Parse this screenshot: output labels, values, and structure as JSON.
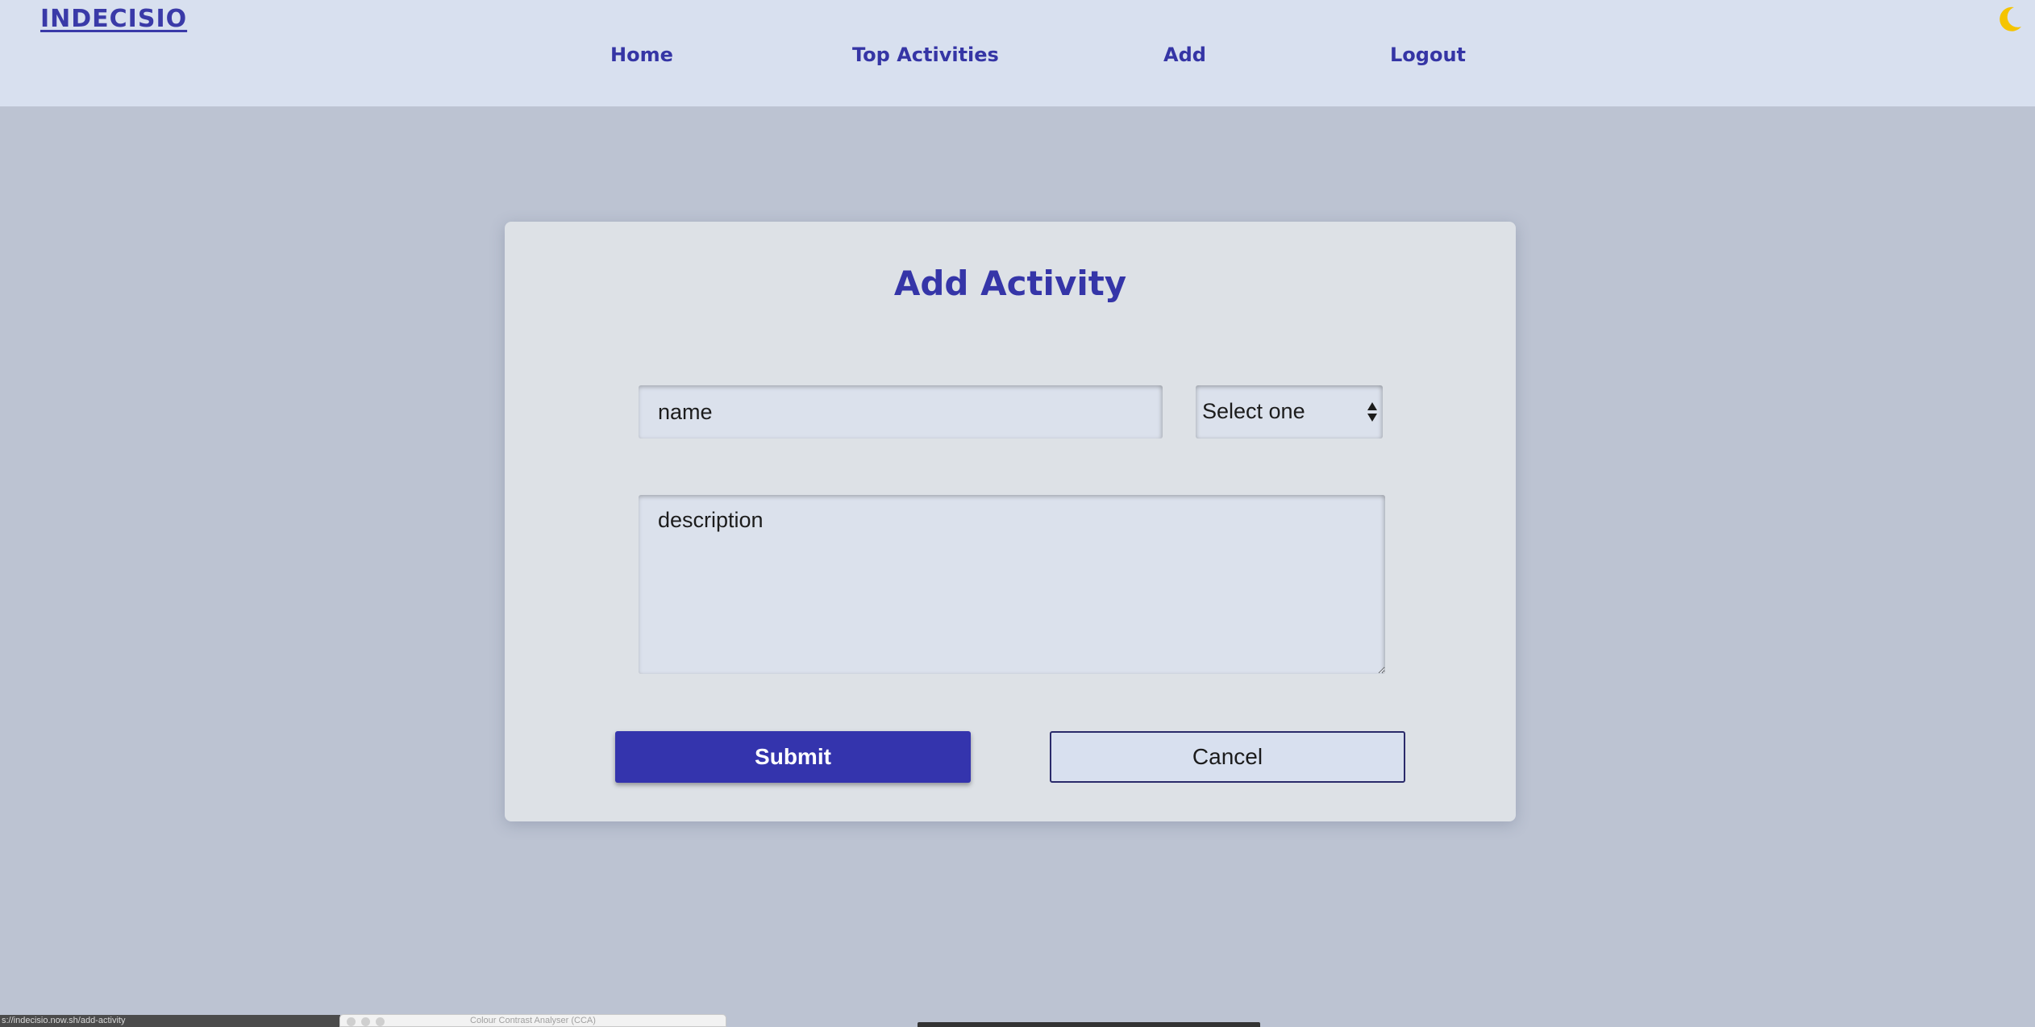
{
  "header": {
    "logo": "INDECISIO",
    "nav": {
      "home": "Home",
      "top_activities": "Top Activities",
      "add": "Add",
      "logout": "Logout"
    },
    "theme_icon": "moon-icon"
  },
  "form": {
    "title": "Add Activity",
    "name_placeholder": "name",
    "select_value": "Select one",
    "description_placeholder": "description",
    "submit_label": "Submit",
    "cancel_label": "Cancel"
  },
  "status_bar": {
    "url": "s://indecisio.now.sh/add-activity"
  },
  "overlay_window": {
    "title": "Colour Contrast Analyser (CCA)"
  },
  "colors": {
    "page_background": "#bcc3d2",
    "header_background": "#d8e0ef",
    "card_background": "#dde1e6",
    "accent": "#3434ad",
    "moon": "#f5c400"
  }
}
